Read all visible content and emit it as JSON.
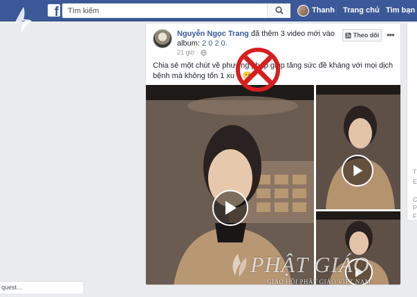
{
  "topbar": {
    "search_placeholder": "Tìm kiếm",
    "profile_name": "Thanh",
    "home_label": "Trang chủ",
    "friends_label": "Tìm bạn bè"
  },
  "watermark": {
    "site_name": "PHẬT GIÁO",
    "sub": "GIÁO HỘI PHẬT GIÁO VIỆT NAM"
  },
  "post": {
    "author": "Nguyễn Ngọc Trang",
    "action": "đã thêm 3 video mới vào album:",
    "album": "2 0 2 0.",
    "time": "21 giờ",
    "follow_label": "Theo dõi",
    "more": "•••",
    "text": "Chia sẻ một chút về phương pháp giúp tăng sức đề kháng với mọi dịch bệnh mà không tốn 1 xu ạ 😁"
  },
  "right_column": {
    "frag_1": "T",
    "frag_2": "E",
    "frag_3": "C",
    "frag_4": "P",
    "frag_5": "F"
  },
  "chat": {
    "label": "quest..."
  },
  "colors": {
    "facebook_blue": "#3b5998",
    "link": "#365899",
    "prohibit_red": "#d81e1e"
  }
}
